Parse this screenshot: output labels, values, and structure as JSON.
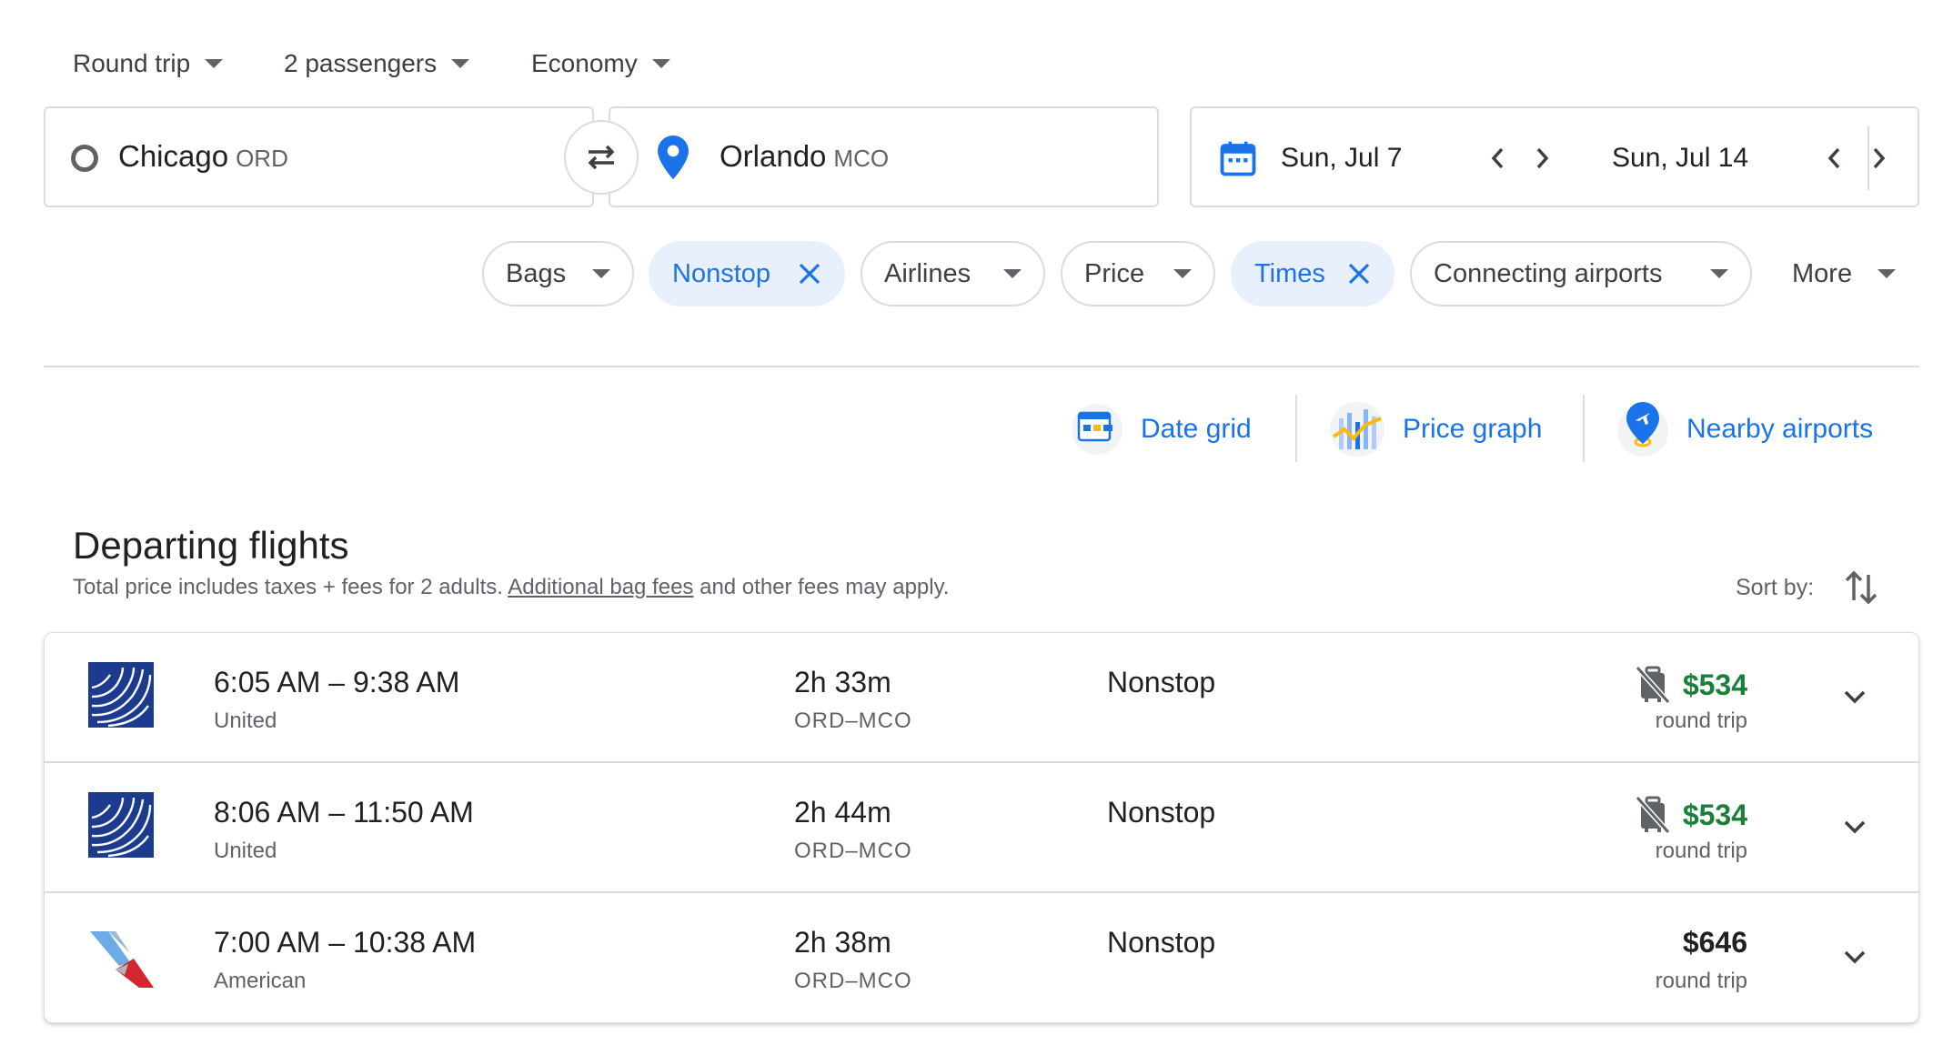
{
  "trip_options": {
    "trip_type": "Round trip",
    "passengers": "2 passengers",
    "cabin": "Economy"
  },
  "search": {
    "origin_city": "Chicago",
    "origin_code": "ORD",
    "destination_city": "Orlando",
    "destination_code": "MCO",
    "depart_date": "Sun, Jul 7",
    "return_date": "Sun, Jul 14"
  },
  "filters": {
    "bags": "Bags",
    "nonstop": "Nonstop",
    "airlines": "Airlines",
    "price": "Price",
    "times": "Times",
    "connecting_airports": "Connecting airports",
    "more": "More"
  },
  "tools": {
    "date_grid": "Date grid",
    "price_graph": "Price graph",
    "nearby_airports": "Nearby airports"
  },
  "results": {
    "title": "Departing flights",
    "subtitle_pre": "Total price includes taxes + fees for 2 adults.",
    "subtitle_link": "Additional bag fees",
    "subtitle_post": "and other fees may apply.",
    "sort_label": "Sort by:",
    "flights": [
      {
        "times": "6:05 AM – 9:38 AM",
        "airline": "United",
        "duration": "2h 33m",
        "route": "ORD–MCO",
        "stops": "Nonstop",
        "price": "$534",
        "price_type": "round trip"
      },
      {
        "times": "8:06 AM – 11:50 AM",
        "airline": "United",
        "duration": "2h 44m",
        "route": "ORD–MCO",
        "stops": "Nonstop",
        "price": "$534",
        "price_type": "round trip"
      },
      {
        "times": "7:00 AM – 10:38 AM",
        "airline": "American",
        "duration": "2h 38m",
        "route": "ORD–MCO",
        "stops": "Nonstop",
        "price": "$646",
        "price_type": "round trip"
      }
    ]
  },
  "colors": {
    "accent": "#1a73e8",
    "chip_active_bg": "#e8f0fe",
    "price_green": "#188038",
    "united_blue": "#1c3b8f"
  }
}
